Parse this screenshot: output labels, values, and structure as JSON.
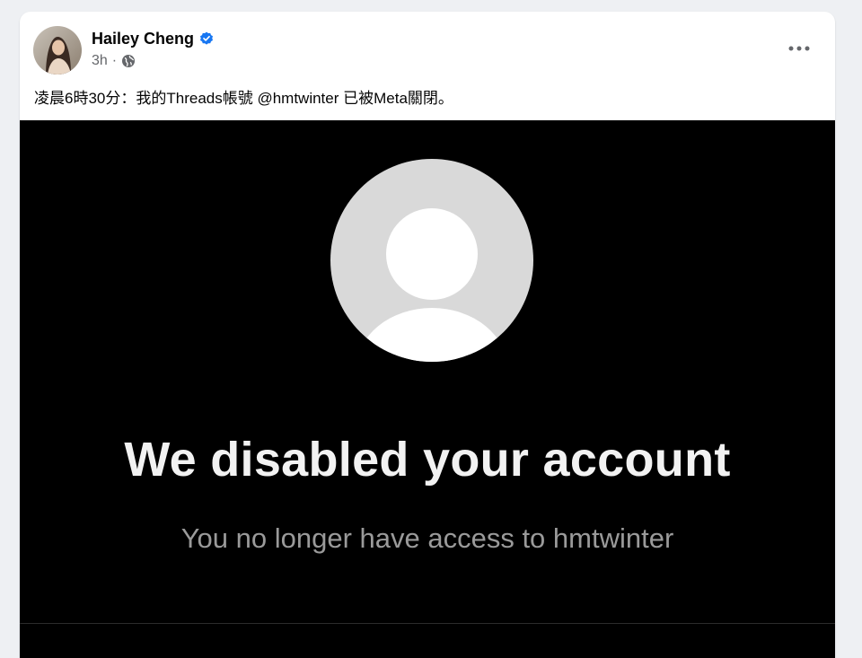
{
  "post": {
    "author": "Hailey Cheng",
    "timestamp": "3h",
    "separator": "·",
    "text": "凌晨6時30分：我的Threads帳號 @hmtwinter 已被Meta關閉。",
    "privacy_icon": "globe-icon",
    "verified_icon": "verified-badge-icon",
    "more_icon": "more-options-icon"
  },
  "media": {
    "title": "We disabled your account",
    "subtitle": "You no longer have access to hmtwinter",
    "background_color": "#000000",
    "placeholder_icon": "default-profile-icon"
  },
  "colors": {
    "verified": "#1877f2",
    "secondary_text": "#65676b",
    "primary_text": "#050505",
    "page_background": "#eef0f3"
  }
}
